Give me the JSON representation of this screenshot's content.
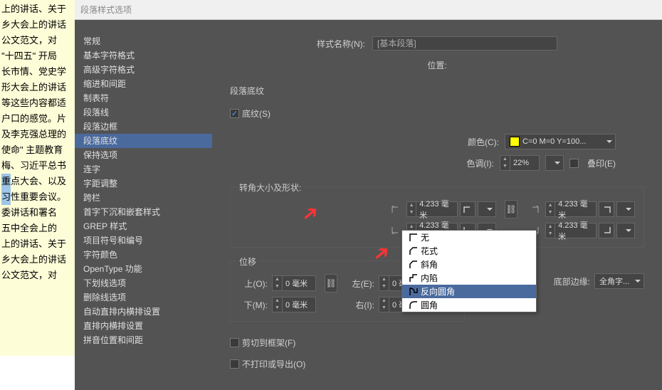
{
  "dialog": {
    "title": "段落样式选项",
    "style_name_label": "样式名称(N):",
    "style_name_value": "[基本段落]",
    "position_label": "位置:"
  },
  "section": {
    "title": "段落底纹",
    "shading_checkbox": "底纹(S)"
  },
  "sidebar": {
    "items": [
      "常规",
      "基本字符格式",
      "高级字符格式",
      "缩进和间距",
      "制表符",
      "段落线",
      "段落边框",
      "段落底纹",
      "保持选项",
      "连字",
      "字距调整",
      "跨栏",
      "首字下沉和嵌套样式",
      "GREP 样式",
      "项目符号和编号",
      "字符颜色",
      "OpenType 功能",
      "下划线选项",
      "删除线选项",
      "自动直排内横排设置",
      "直排内横排设置",
      "拼音位置和间距"
    ],
    "selected_index": 7
  },
  "attrs": {
    "color_label": "颜色(C):",
    "color_value": "C=0 M=0 Y=100...",
    "tint_label": "色调(I):",
    "tint_value": "22%",
    "overprint_label": "叠印(E)"
  },
  "corners": {
    "legend": "转角大小及形状:",
    "tl": "4.233 毫米",
    "tr": "4.233 毫米",
    "bl": "4.233 毫米",
    "br": "4.233 毫米"
  },
  "offset": {
    "legend": "位移",
    "top_label": "上(O):",
    "top_value": "0 毫米",
    "bottom_label": "下(M):",
    "bottom_value": "0 毫米",
    "left_label": "左(E):",
    "left_value": "0 毫米",
    "right_label": "右(I):",
    "right_value": "0 毫米",
    "bottom_edge_label": "底部边缘:",
    "bottom_edge_value": "全角字..."
  },
  "clip": {
    "clip_to_frame": "剪切到框架(F)",
    "no_print_export": "不打印或导出(O)"
  },
  "corner_menu": {
    "items": [
      "无",
      "花式",
      "斜角",
      "内陷",
      "反向圆角",
      "圆角"
    ],
    "hover_index": 4
  },
  "bg_text": [
    "上的讲话、关于",
    "乡大会上的讲话",
    "公文范文，对",
    "",
    "\"十四五\" 开局",
    "长市情、党史学",
    "形大会上的讲话",
    "等这些内容都适",
    "",
    "",
    "",
    "户口的感觉。片",
    "",
    "及李克强总理的",
    "",
    "使命\" 主题教育",
    "梅、习近平总书",
    "重点大会、以及",
    "习性重要会议。",
    "委讲话和署名",
    "五中全会上的",
    "上的讲话、关于",
    "乡大会上的讲话",
    "公文范文，对"
  ]
}
